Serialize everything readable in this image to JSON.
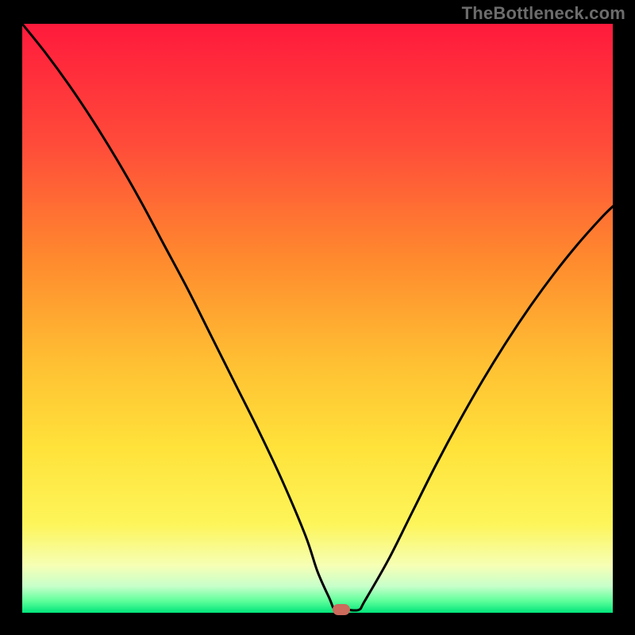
{
  "watermark": "TheBottleneck.com",
  "chart_data": {
    "type": "line",
    "title": "",
    "xlabel": "",
    "ylabel": "",
    "xlim": [
      0,
      100
    ],
    "ylim": [
      0,
      100
    ],
    "grid": false,
    "legend": false,
    "background_gradient": {
      "stops": [
        {
          "pos": 0.0,
          "color": "#ff1a3c"
        },
        {
          "pos": 0.2,
          "color": "#ff4a3a"
        },
        {
          "pos": 0.4,
          "color": "#ff8a2e"
        },
        {
          "pos": 0.58,
          "color": "#ffc133"
        },
        {
          "pos": 0.72,
          "color": "#ffe23a"
        },
        {
          "pos": 0.85,
          "color": "#fdf55a"
        },
        {
          "pos": 0.92,
          "color": "#f6ffb5"
        },
        {
          "pos": 0.955,
          "color": "#c7ffca"
        },
        {
          "pos": 0.98,
          "color": "#5fff9b"
        },
        {
          "pos": 1.0,
          "color": "#00e57a"
        }
      ]
    },
    "series": [
      {
        "name": "bottleneck-curve",
        "color": "#000000",
        "stroke_width": 3,
        "x": [
          0,
          4,
          8,
          12,
          16,
          20,
          24,
          28,
          32,
          36,
          40,
          44,
          48,
          50,
          52,
          53,
          55,
          57,
          58,
          62,
          66,
          70,
          74,
          78,
          82,
          86,
          90,
          94,
          98,
          100
        ],
        "y": [
          100,
          95,
          89.5,
          83.5,
          77,
          70,
          62.5,
          55,
          47,
          39,
          31,
          22.5,
          13,
          7,
          2.5,
          0.5,
          0.5,
          0.5,
          2,
          9,
          17,
          25,
          32.5,
          39.5,
          46,
          52,
          57.5,
          62.5,
          67,
          69
        ]
      }
    ],
    "marker": {
      "x": 54,
      "y": 0.6,
      "color": "#cc6a5c"
    }
  }
}
